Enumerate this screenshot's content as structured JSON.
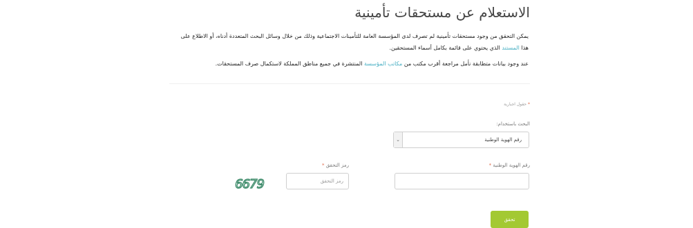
{
  "page": {
    "title": "الاستعلام عن مستحقات تأمينية",
    "intro": {
      "p1_a": "يمكن التحقق من وجود مستحقات تأمينية لم تصرف لدى المؤسسة العامة للتأمينات الاجتماعية وذلك من خلال وسائل البحث المتعددة أدناه، أو الاطلاع على هذا ",
      "p1_link": "المستند",
      "p1_b": " الذي يحتوي على قائمة بكامل أسماء المستحقين.",
      "p2_a": "عند وجود بيانات متطابقة نأمل مراجعة أقرب مكتب من ",
      "p2_link": "مكاتب المؤسسة",
      "p2_b": " المنتشرة في جميع مناطق المملكة لاستكمال صرف المستحقات."
    }
  },
  "form": {
    "required_note": "حقول اجبارية",
    "required_mark": "*",
    "search_by_label": "البحث باستخدام:",
    "search_by_selected": "رقم الهوية الوطنية",
    "national_id_label": "رقم الهوية الوطنية",
    "national_id_value": "",
    "captcha_label": "رمز التحقق",
    "captcha_placeholder": "رمز التحقق",
    "captcha_value": "",
    "captcha_text": "6679",
    "submit_label": "تحقق"
  },
  "colors": {
    "link": "#4ab0c4",
    "submit": "#a3c932",
    "captcha": "#3d8b6a"
  },
  "icons": {
    "select_arrow": "chevron-down-icon"
  }
}
